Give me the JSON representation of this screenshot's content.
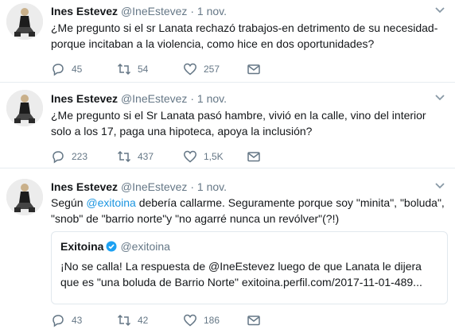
{
  "tweets": [
    {
      "name": "Ines Estevez",
      "handle": "@IneEstevez",
      "separator": "·",
      "time": "1 nov.",
      "text": "¿Me pregunto si el sr Lanata rechazó trabajos-en detrimento de su necesidad-porque incitaban a la violencia, como hice en dos oportunidades?",
      "replies": "45",
      "retweets": "54",
      "likes": "257"
    },
    {
      "name": "Ines Estevez",
      "handle": "@IneEstevez",
      "separator": "·",
      "time": "1 nov.",
      "text": "¿Me pregunto si el Sr Lanata pasó hambre, vivió en la calle, vino del interior solo a los 17, paga una hipoteca, apoya la inclusión?",
      "replies": "223",
      "retweets": "437",
      "likes": "1,5K"
    },
    {
      "name": "Ines Estevez",
      "handle": "@IneEstevez",
      "separator": "·",
      "time": "1 nov.",
      "text_before": "Según ",
      "mention": "@exitoina",
      "text_after": " debería callarme. Seguramente porque soy \"minita\", \"boluda\", \"snob\" de \"barrio norte\"y \"no agarré nunca un revólver\"(?!)",
      "quote": {
        "name": "Exitoina",
        "handle": "@exitoina",
        "text": "¡No se calla! La respuesta de @IneEstevez luego de que Lanata le dijera que es \"una boluda de Barrio Norte\" exitoina.perfil.com/2017-11-01-489..."
      },
      "replies": "43",
      "retweets": "42",
      "likes": "186"
    }
  ],
  "colors": {
    "text": "#14171a",
    "secondary": "#657786",
    "link": "#1b95e0",
    "divider": "#e6ecf0",
    "verified": "#1da1f2"
  },
  "icons": [
    "reply-icon",
    "retweet-icon",
    "like-icon",
    "message-icon",
    "chevron-down-icon",
    "verified-icon"
  ]
}
